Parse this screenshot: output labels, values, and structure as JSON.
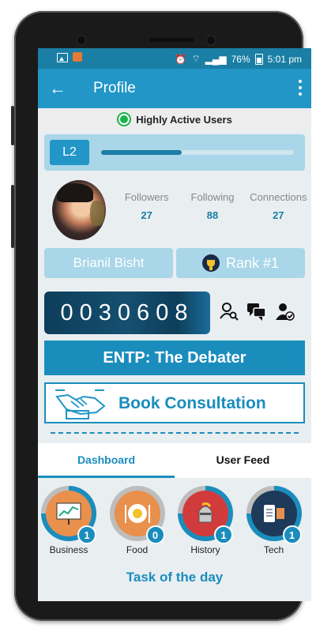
{
  "status_bar": {
    "battery": "76%",
    "time": "5:01 pm"
  },
  "app_bar": {
    "back_icon": "arrow-left-icon",
    "title": "Profile",
    "menu_icon": "more-vert-icon"
  },
  "activity": {
    "label": "Highly Active Users",
    "indicator_color": "#19b34a"
  },
  "level": {
    "badge": "L2",
    "progress": 0.42
  },
  "stats": [
    {
      "label": "Followers",
      "value": "27"
    },
    {
      "label": "Following",
      "value": "88"
    },
    {
      "label": "Connections",
      "value": "27"
    }
  ],
  "profile": {
    "name": "Brianil Bisht",
    "rank": "Rank #1",
    "points": "0030608"
  },
  "personality": "ENTP: The Debater",
  "consultation": {
    "label": "Book Consultation"
  },
  "tabs": [
    {
      "label": "Dashboard",
      "active": true
    },
    {
      "label": "User Feed",
      "active": false
    }
  ],
  "categories": [
    {
      "label": "Business",
      "count": "1",
      "color": "#e8904c"
    },
    {
      "label": "Food",
      "count": "0",
      "color": "#e8904c"
    },
    {
      "label": "History",
      "count": "1",
      "color": "#d23b3b"
    },
    {
      "label": "Tech",
      "count": "1",
      "color": "#1e3a5a"
    }
  ],
  "task_of_day": "Task of the day",
  "colors": {
    "primary": "#2196c7",
    "accent": "#1a8dbd",
    "status_bar": "#1a7ea5"
  }
}
